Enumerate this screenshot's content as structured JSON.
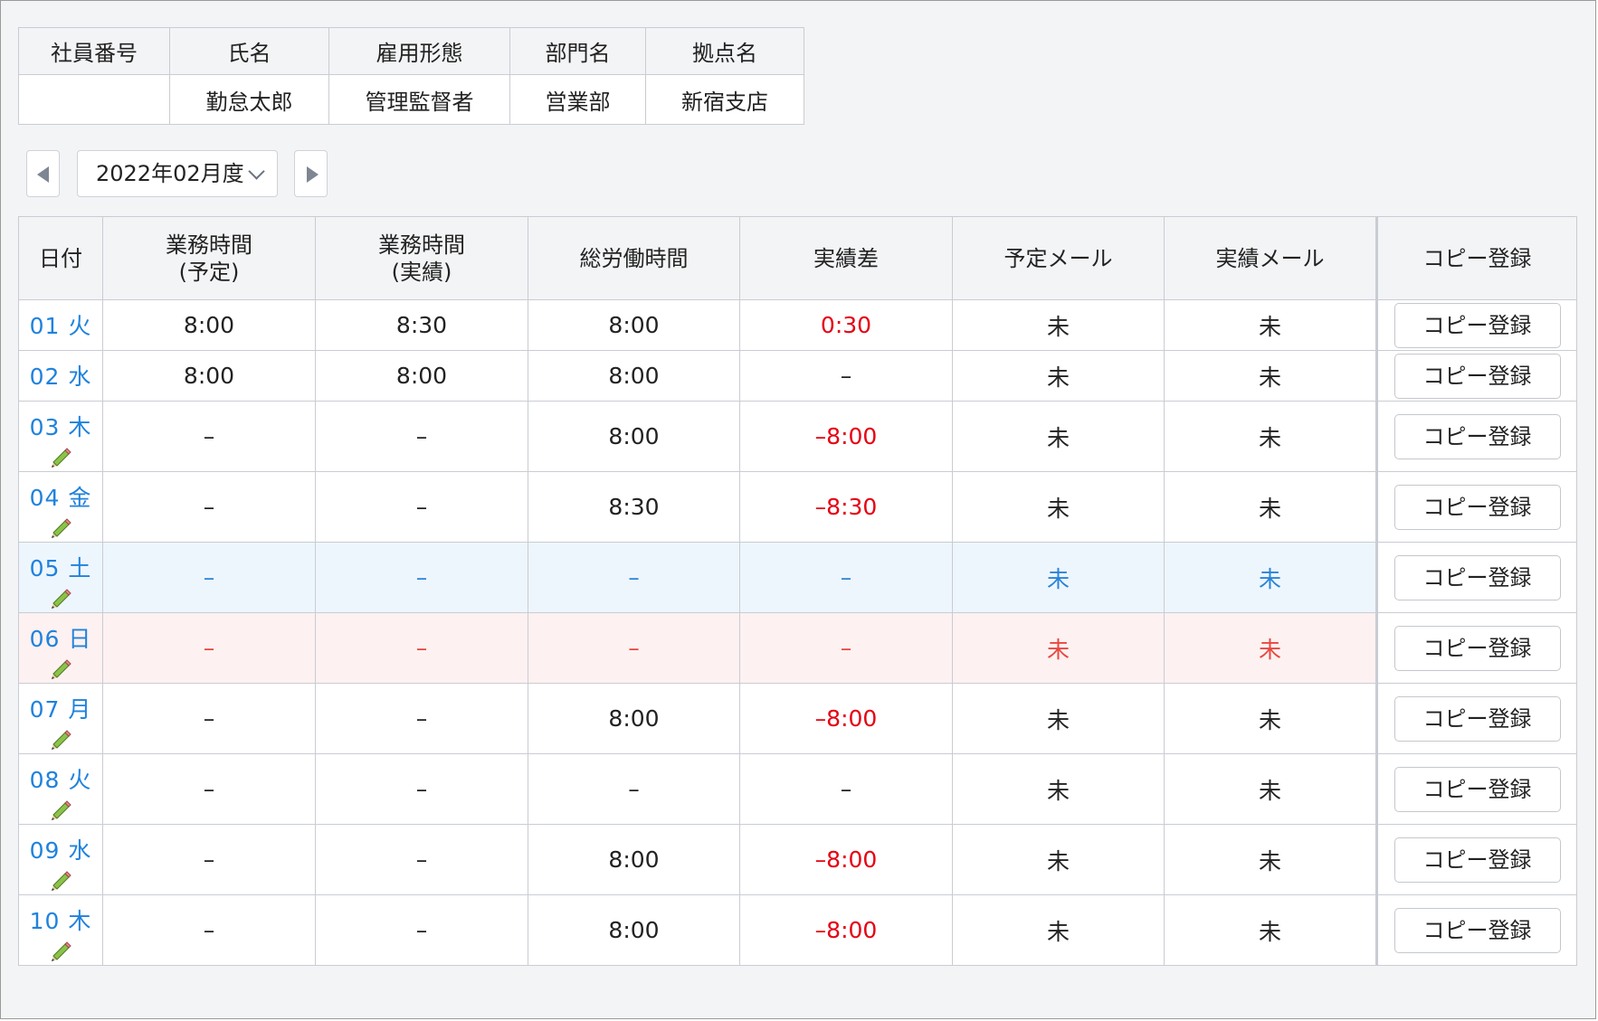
{
  "employee": {
    "headers": [
      "社員番号",
      "氏名",
      "雇用形態",
      "部門名",
      "拠点名"
    ],
    "values": [
      "",
      "勤怠太郎",
      "管理監督者",
      "営業部",
      "新宿支店"
    ]
  },
  "month_nav": {
    "selected": "2022年02月度"
  },
  "attendance": {
    "headers": {
      "date": "日付",
      "planned_l1": "業務時間",
      "planned_l2": "(予定)",
      "actual_l1": "業務時間",
      "actual_l2": "(実績)",
      "total": "総労働時間",
      "diff": "実績差",
      "plan_mail": "予定メール",
      "actual_mail": "実績メール",
      "copy": "コピー登録"
    },
    "copy_button_label": "コピー登録",
    "rows": [
      {
        "date": "01 火",
        "planned": "8:00",
        "actual": "8:30",
        "total": "8:00",
        "diff": "0:30",
        "diff_negative": true,
        "plan_mail": "未",
        "actual_mail": "未",
        "edit": false,
        "day_type": "weekday"
      },
      {
        "date": "02 水",
        "planned": "8:00",
        "actual": "8:00",
        "total": "8:00",
        "diff": "–",
        "diff_negative": false,
        "plan_mail": "未",
        "actual_mail": "未",
        "edit": false,
        "day_type": "weekday"
      },
      {
        "date": "03 木",
        "planned": "–",
        "actual": "–",
        "total": "8:00",
        "diff": "–8:00",
        "diff_negative": true,
        "plan_mail": "未",
        "actual_mail": "未",
        "edit": true,
        "day_type": "weekday"
      },
      {
        "date": "04 金",
        "planned": "–",
        "actual": "–",
        "total": "8:30",
        "diff": "–8:30",
        "diff_negative": true,
        "plan_mail": "未",
        "actual_mail": "未",
        "edit": true,
        "day_type": "weekday"
      },
      {
        "date": "05 土",
        "planned": "–",
        "actual": "–",
        "total": "–",
        "diff": "–",
        "diff_negative": false,
        "plan_mail": "未",
        "actual_mail": "未",
        "edit": true,
        "day_type": "saturday"
      },
      {
        "date": "06 日",
        "planned": "–",
        "actual": "–",
        "total": "–",
        "diff": "–",
        "diff_negative": false,
        "plan_mail": "未",
        "actual_mail": "未",
        "edit": true,
        "day_type": "sunday"
      },
      {
        "date": "07 月",
        "planned": "–",
        "actual": "–",
        "total": "8:00",
        "diff": "–8:00",
        "diff_negative": true,
        "plan_mail": "未",
        "actual_mail": "未",
        "edit": true,
        "day_type": "weekday"
      },
      {
        "date": "08 火",
        "planned": "–",
        "actual": "–",
        "total": "–",
        "diff": "–",
        "diff_negative": false,
        "plan_mail": "未",
        "actual_mail": "未",
        "edit": true,
        "day_type": "weekday"
      },
      {
        "date": "09 水",
        "planned": "–",
        "actual": "–",
        "total": "8:00",
        "diff": "–8:00",
        "diff_negative": true,
        "plan_mail": "未",
        "actual_mail": "未",
        "edit": true,
        "day_type": "weekday"
      },
      {
        "date": "10 木",
        "planned": "–",
        "actual": "–",
        "total": "8:00",
        "diff": "–8:00",
        "diff_negative": true,
        "plan_mail": "未",
        "actual_mail": "未",
        "edit": true,
        "day_type": "weekday"
      }
    ]
  },
  "colors": {
    "link": "#1f82dd",
    "negative": "#e60012",
    "saturday_bg": "#eef6fd",
    "saturday_text": "#2a84d9",
    "sunday_bg": "#fdf1f1",
    "sunday_text": "#e8473f"
  },
  "icons": {
    "prev": "triangle-left-icon",
    "next": "triangle-right-icon",
    "dropdown": "chevron-down-icon",
    "edit": "pencil-icon"
  }
}
